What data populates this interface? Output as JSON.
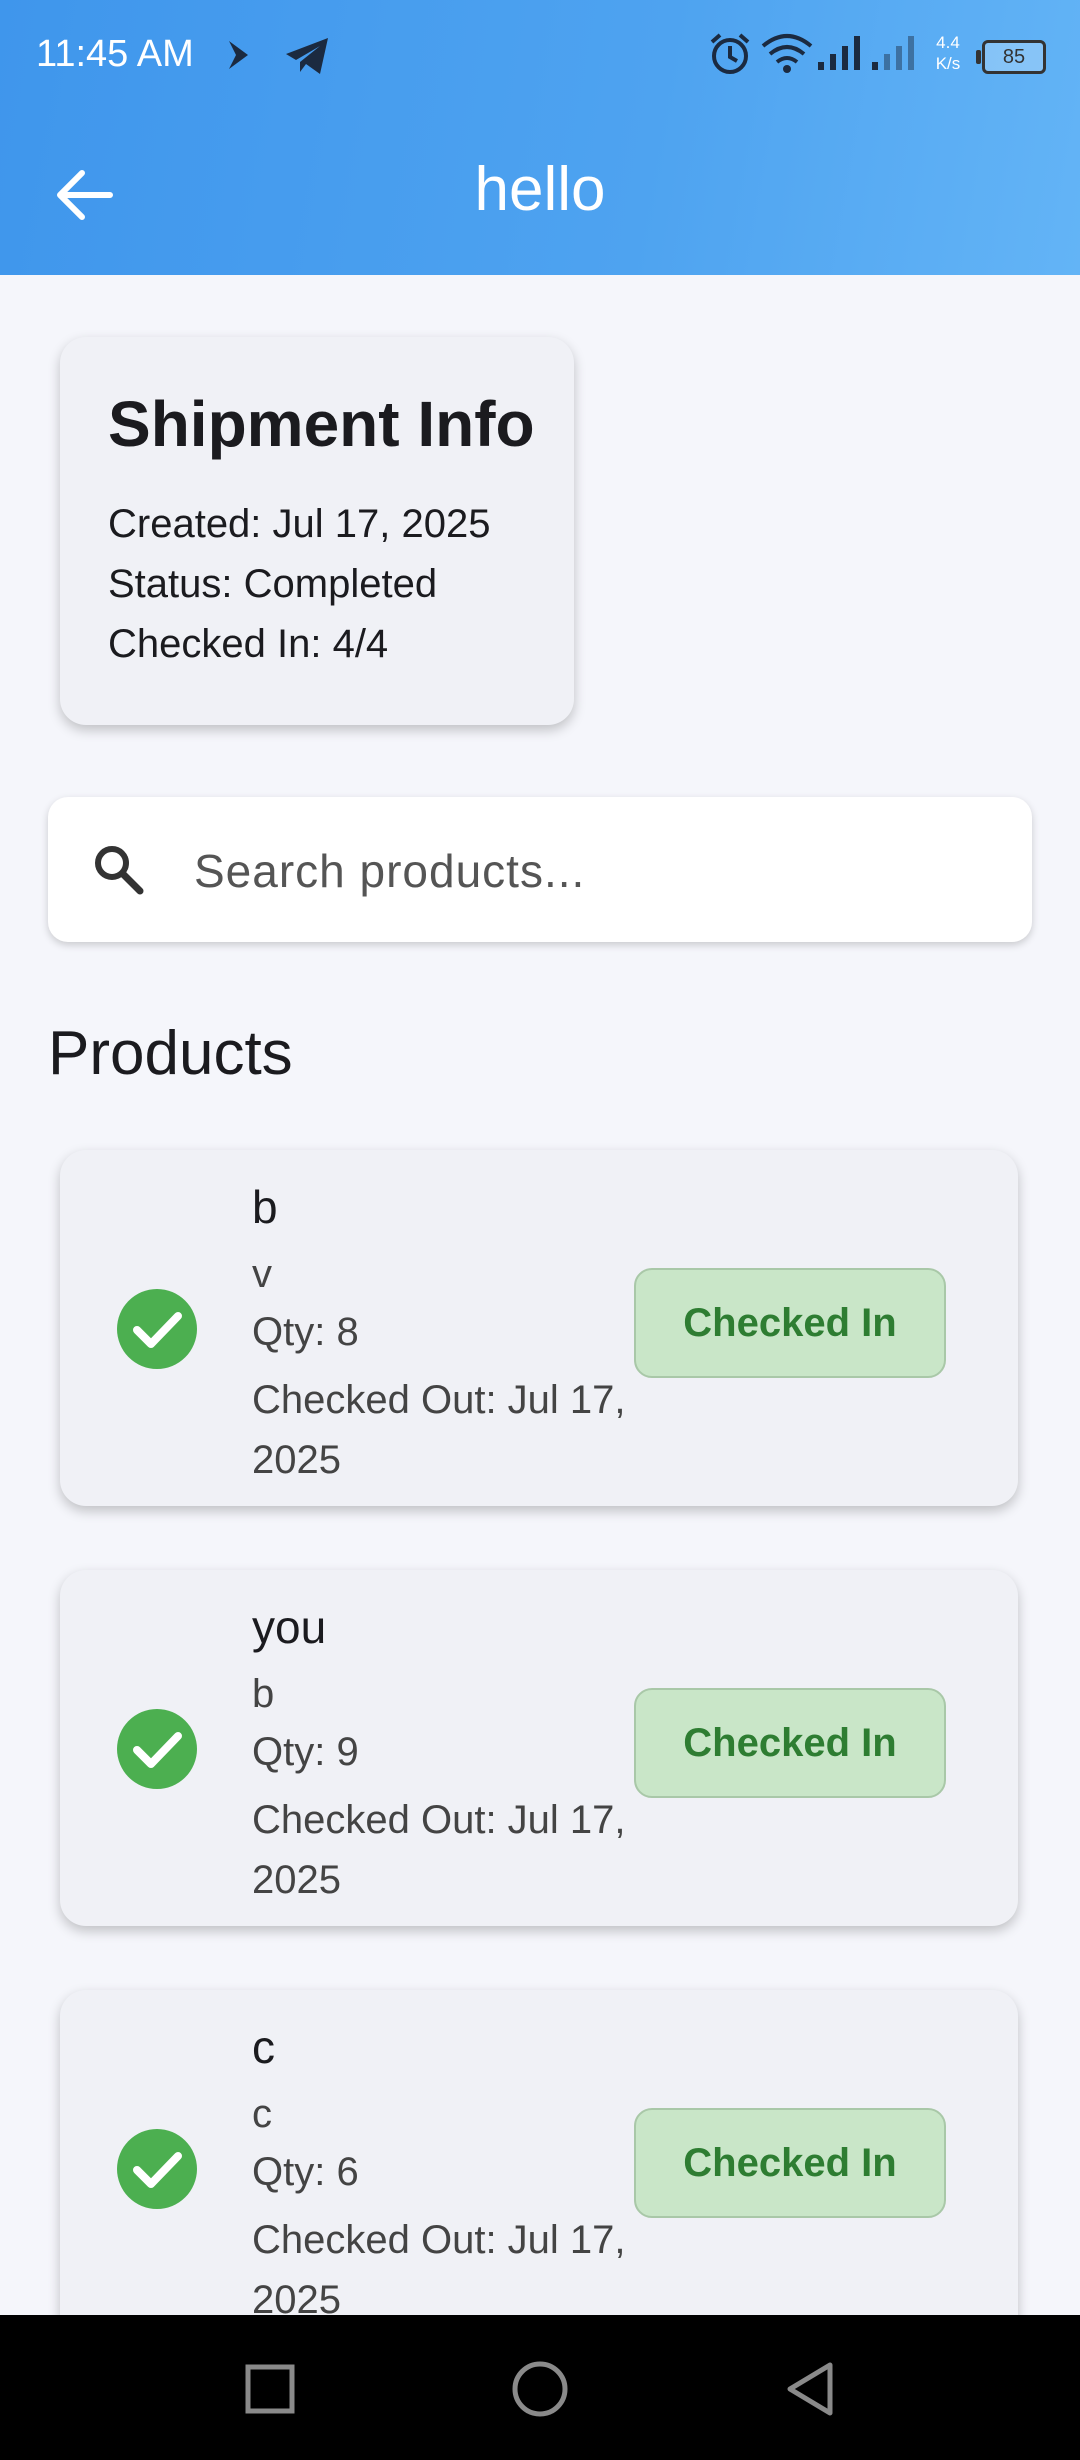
{
  "status_bar": {
    "time": "11:45 AM",
    "net_speed_value": "4.4",
    "net_speed_unit": "K/s",
    "battery": "85",
    "icons": [
      "bluetooth-share-icon",
      "telegram-icon",
      "alarm-icon",
      "wifi-icon",
      "signal-icon",
      "signal-icon"
    ]
  },
  "app_bar": {
    "title": "hello",
    "back_icon": "arrow-back-icon",
    "color": "#4a9ff0"
  },
  "shipment": {
    "title": "Shipment Info",
    "created": "Created: Jul 17, 2025",
    "status": "Status: Completed",
    "checked_in": "Checked In: 4/4"
  },
  "search": {
    "placeholder": "Search products...",
    "value": ""
  },
  "products_heading": "Products",
  "products": [
    {
      "name": "b",
      "subtitle": "v",
      "qty": "Qty: 8",
      "checked_out": "Checked Out: Jul 17, 2025",
      "status_label": "Checked In"
    },
    {
      "name": "you",
      "subtitle": "b",
      "qty": "Qty: 9",
      "checked_out": "Checked Out: Jul 17, 2025",
      "status_label": "Checked In"
    },
    {
      "name": "c",
      "subtitle": "c",
      "qty": "Qty: 6",
      "checked_out": "Checked Out: Jul 17, 2025",
      "status_label": "Checked In"
    }
  ],
  "colors": {
    "success": "#4caf50",
    "button_bg": "#c9e6c8",
    "button_text": "#2e7d32"
  },
  "nav_bar": {
    "icons": [
      "recents-square-icon",
      "home-circle-icon",
      "back-triangle-icon"
    ]
  }
}
